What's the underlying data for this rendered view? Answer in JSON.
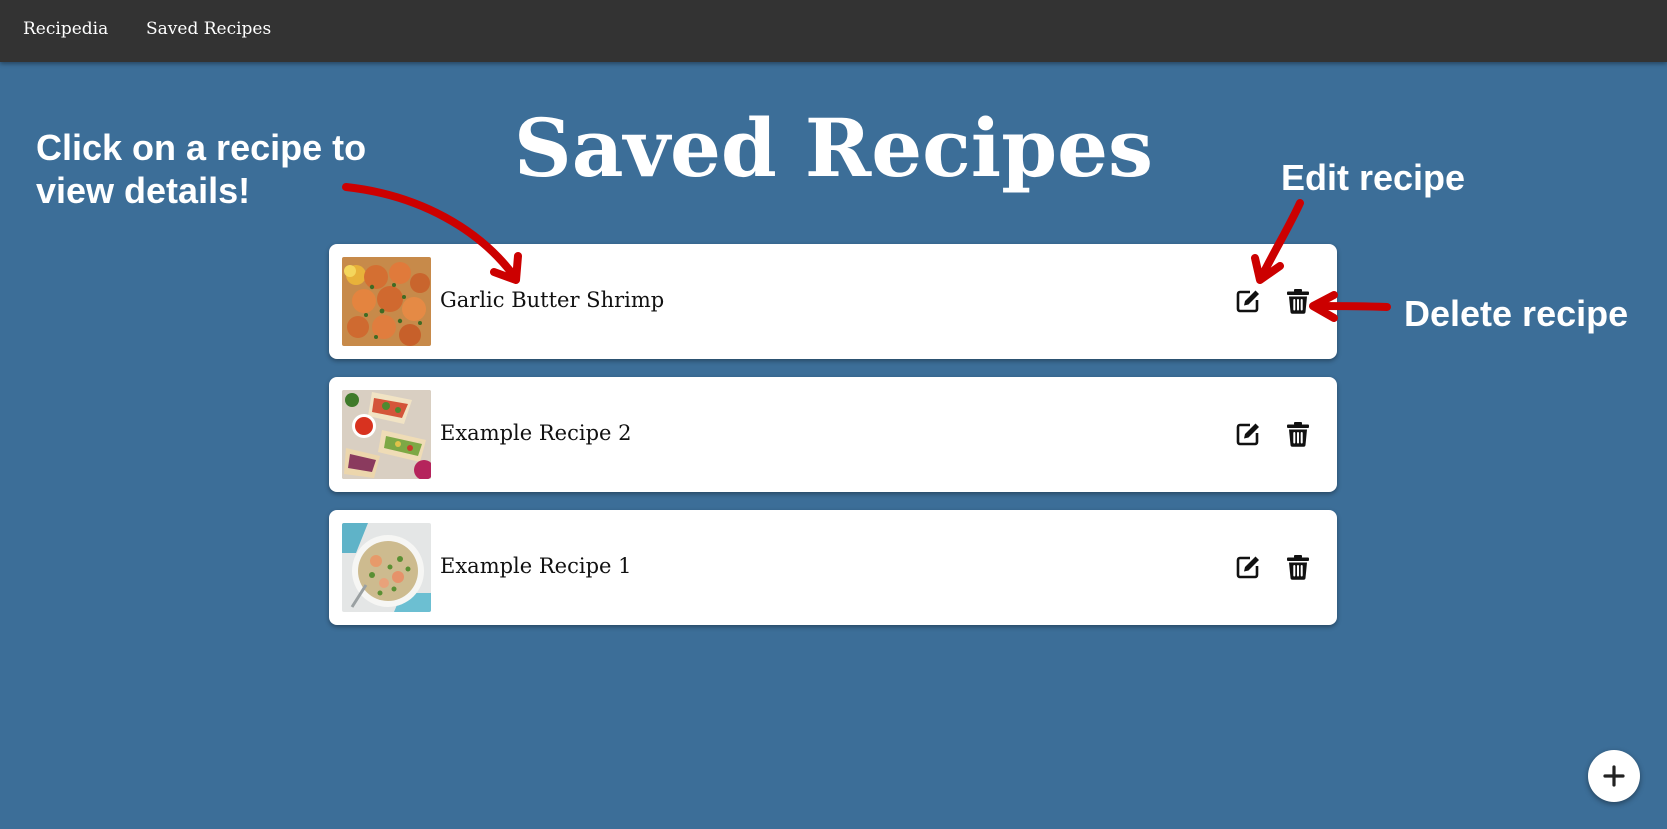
{
  "nav": {
    "brand": "Recipedia",
    "saved_recipes": "Saved Recipes"
  },
  "page": {
    "title": "Saved Recipes"
  },
  "recipes": [
    {
      "name": "Garlic Butter Shrimp"
    },
    {
      "name": "Example Recipe 2"
    },
    {
      "name": "Example Recipe 1"
    }
  ],
  "annotations": {
    "click_line1": "Click on a recipe to",
    "click_line2": "view details!",
    "edit": "Edit recipe",
    "delete": "Delete recipe"
  },
  "icons": {
    "edit": "edit-icon",
    "delete": "trash-icon",
    "add": "plus-icon"
  },
  "colors": {
    "background": "#3c6e98",
    "navbar": "#333333",
    "annotation_arrow": "#cc0000"
  }
}
